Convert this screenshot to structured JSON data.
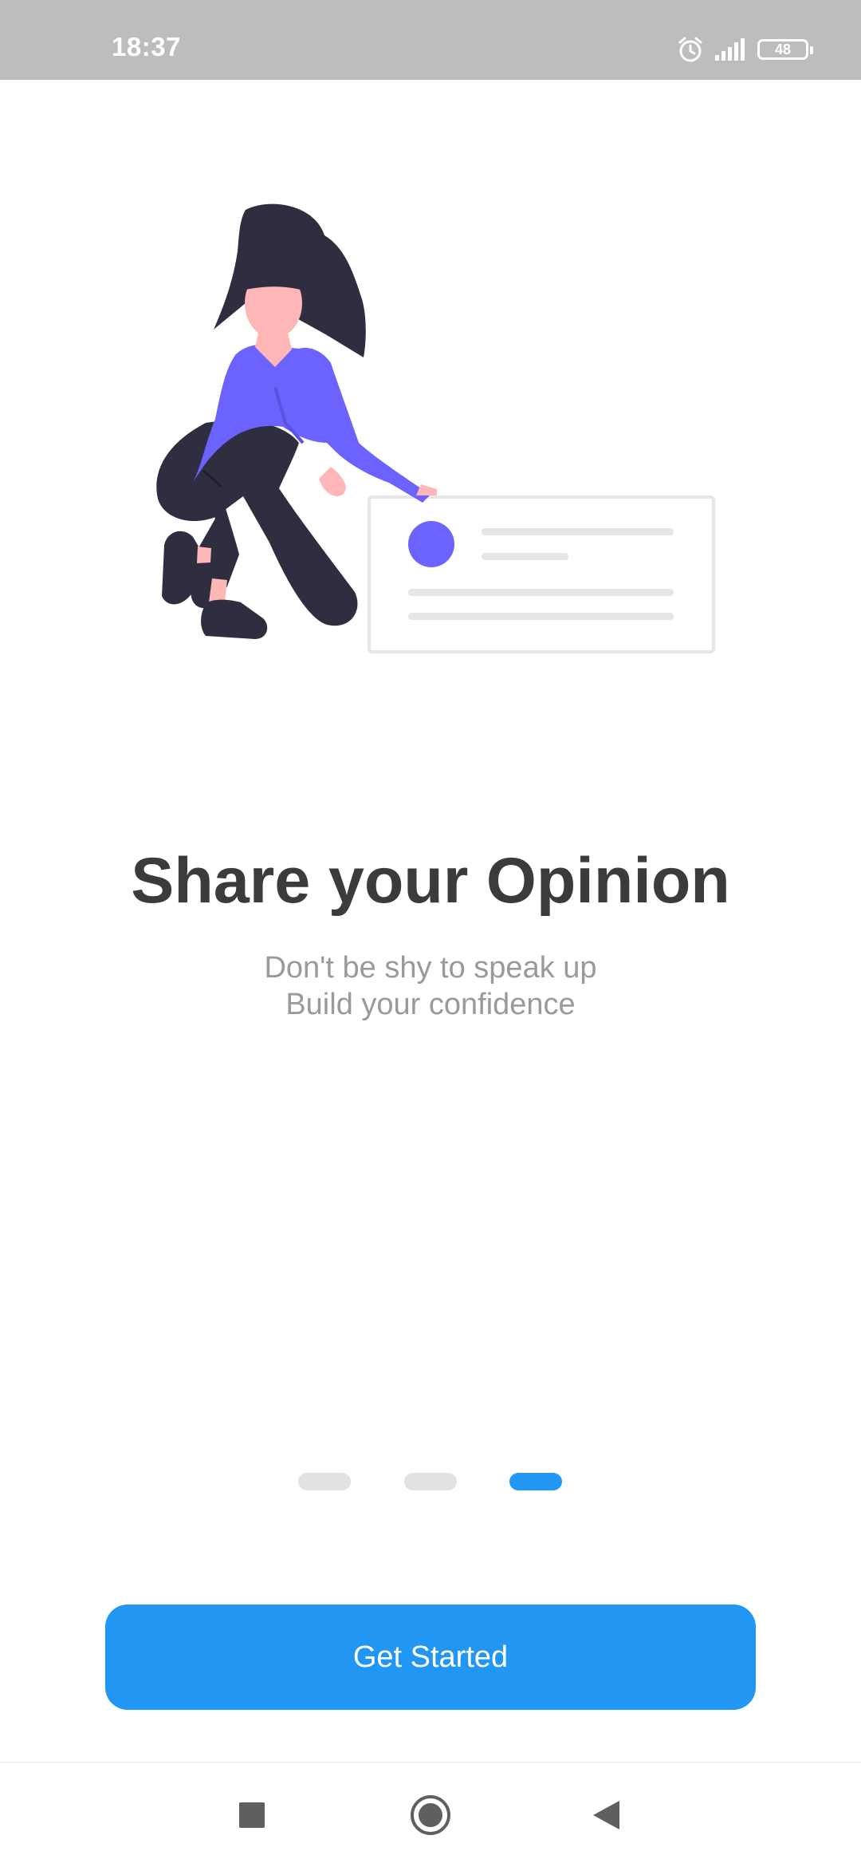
{
  "status_bar": {
    "time": "18:37",
    "icons": [
      "alarm-icon",
      "signal-icon",
      "battery-icon"
    ],
    "battery_level": "48",
    "background": "#bdbdbd"
  },
  "onboarding": {
    "title": "Share your Opinion",
    "subtitle_line1": "Don't be shy to speak up",
    "subtitle_line2": "Build your confidence",
    "page_count": 3,
    "active_page": 3,
    "accent_color": "#2196f3"
  },
  "actions": {
    "get_started_label": "Get Started"
  },
  "nav_bar": {
    "items": [
      "recents-square-icon",
      "home-circle-icon",
      "back-triangle-icon"
    ]
  }
}
